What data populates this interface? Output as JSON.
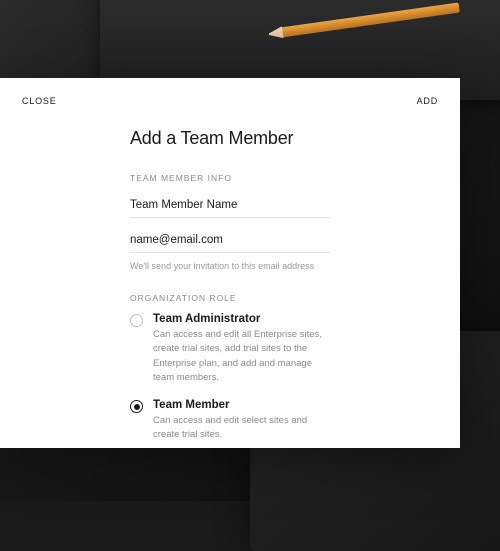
{
  "header": {
    "close_label": "CLOSE",
    "add_label": "ADD"
  },
  "modal": {
    "title": "Add a Team Member"
  },
  "sections": {
    "info_label": "TEAM MEMBER INFO",
    "role_label": "ORGANIZATION ROLE"
  },
  "fields": {
    "name_placeholder": "Team Member Name",
    "email_placeholder": "name@email.com",
    "email_helper": "We'll send your invitation to this email address"
  },
  "roles": {
    "admin": {
      "title": "Team Administrator",
      "description": "Can access and edit all Enterprise sites, create trial sites, add trial sites to the Enterprise plan, and add and manage team members.",
      "selected": false
    },
    "member": {
      "title": "Team Member",
      "description": "Can access and edit select sites and create trial sites.",
      "selected": true
    }
  }
}
